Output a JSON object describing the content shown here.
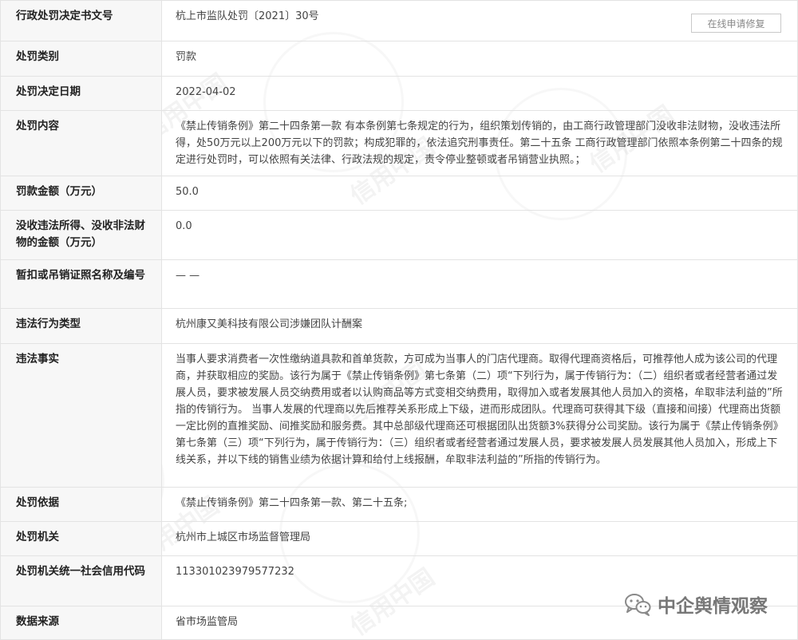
{
  "rows": [
    {
      "label": "行政处罚决定书文号",
      "value": "杭上市监队处罚〔2021〕30号"
    },
    {
      "label": "处罚类别",
      "value": "罚款"
    },
    {
      "label": "处罚决定日期",
      "value": "2022-04-02"
    },
    {
      "label": "处罚内容",
      "value": "《禁止传销条例》第二十四条第一款 有本条例第七条规定的行为，组织策划传销的，由工商行政管理部门没收非法财物，没收违法所得，处50万元以上200万元以下的罚款；构成犯罪的，依法追究刑事责任。第二十五条 工商行政管理部门依照本条例第二十四条的规定进行处罚时，可以依照有关法律、行政法规的规定，责令停业整顿或者吊销营业执照。；"
    },
    {
      "label": "罚款金额（万元）",
      "value": "50.0"
    },
    {
      "label": "没收违法所得、没收非法财物的金额（万元）",
      "value": "0.0"
    },
    {
      "label": "暂扣或吊销证照名称及编号",
      "value": "— —"
    },
    {
      "label": "违法行为类型",
      "value": "杭州康又美科技有限公司涉嫌团队计酬案"
    },
    {
      "label": "违法事实",
      "value": "当事人要求消费者一次性缴纳道具款和首单货款，方可成为当事人的门店代理商。取得代理商资格后，可推荐他人成为该公司的代理商，并获取相应的奖励。该行为属于《禁止传销条例》第七条第（二）项“下列行为，属于传销行为：（二）组织者或者经营者通过发展人员，要求被发展人员交纳费用或者以认购商品等方式变相交纳费用，取得加入或者发展其他人员加入的资格，牟取非法利益的”所指的传销行为。 当事人发展的代理商以先后推荐关系形成上下级，进而形成团队。代理商可获得其下级（直接和间接）代理商出货额一定比例的直推奖励、间推奖励和服务费。其中总部级代理商还可根据团队出货额3%获得分公司奖励。该行为属于《禁止传销条例》第七条第（三）项“下列行为，属于传销行为：（三）组织者或者经营者通过发展人员，要求被发展人员发展其他人员加入，形成上下线关系，并以下线的销售业绩为依据计算和给付上线报酬，牟取非法利益的”所指的传销行为。"
    },
    {
      "label": "处罚依据",
      "value": "《禁止传销条例》第二十四条第一款、第二十五条;"
    },
    {
      "label": "处罚机关",
      "value": "杭州市上城区市场监督管理局"
    },
    {
      "label": "处罚机关统一社会信用代码",
      "value": "113301023979577232"
    },
    {
      "label": "数据来源",
      "value": "省市场监管局"
    }
  ],
  "repair_button": "在线申请修复",
  "watermark_text": "信用中国",
  "brand": {
    "name": "中企舆情观察",
    "icon": "wechat-icon"
  }
}
